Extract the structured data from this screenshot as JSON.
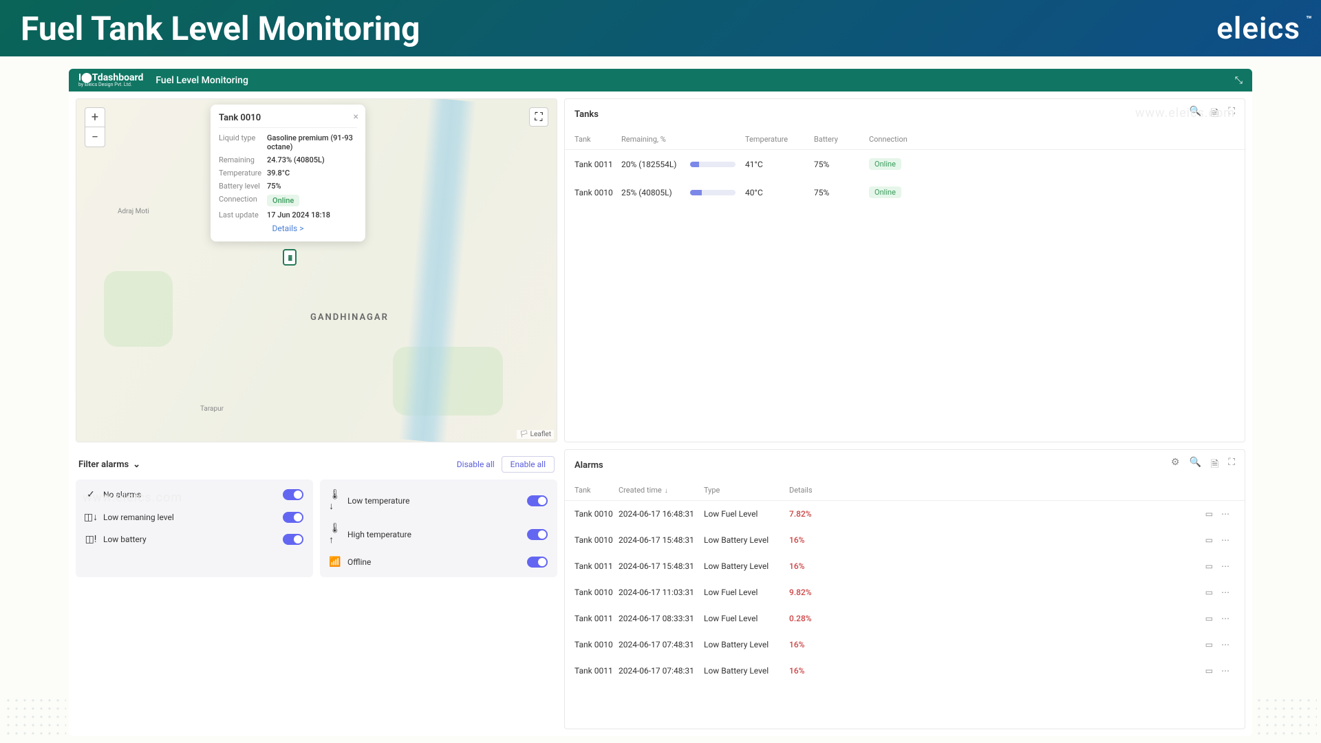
{
  "page": {
    "title": "Fuel Tank Level Monitoring",
    "brand": "eleics",
    "watermark": "www.eleics.com"
  },
  "dashboard": {
    "logo": "I⬤Tdashboard",
    "logo_sub": "by Eleics Design Pvt. Ltd.",
    "title": "Fuel Level Monitoring"
  },
  "map": {
    "city_label": "GANDHINAGAR",
    "place1": "Adraj Moti",
    "place2": "Tarapur",
    "leaflet": "Leaflet"
  },
  "popup": {
    "title": "Tank 0010",
    "details_link": "Details >",
    "labels": {
      "liquid": "Liquid type",
      "remaining": "Remaining",
      "temperature": "Temperature",
      "battery": "Battery level",
      "connection": "Connection",
      "last_update": "Last update"
    },
    "values": {
      "liquid": "Gasoline premium (91-93 octane)",
      "remaining": "24.73% (40805L)",
      "temperature": "39.8°C",
      "battery": "75%",
      "connection": "Online",
      "last_update": "17 Jun 2024 18:18"
    }
  },
  "filters": {
    "title": "Filter alarms",
    "disable_all": "Disable all",
    "enable_all": "Enable all",
    "left": [
      {
        "icon": "✓",
        "label": "No alarms"
      },
      {
        "icon": "◫↓",
        "label": "Low remaning level"
      },
      {
        "icon": "◫!",
        "label": "Low battery"
      }
    ],
    "right": [
      {
        "icon": "🌡↓",
        "label": "Low temperature"
      },
      {
        "icon": "🌡↑",
        "label": "High temperature"
      },
      {
        "icon": "📶",
        "label": "Offline"
      }
    ]
  },
  "tanks": {
    "title": "Tanks",
    "headers": {
      "tank": "Tank",
      "remaining": "Remaining, %",
      "temperature": "Temperature",
      "battery": "Battery",
      "connection": "Connection"
    },
    "rows": [
      {
        "tank": "Tank 0011",
        "remaining": "20% (182554L)",
        "pct": 20,
        "temperature": "41°C",
        "battery": "75%",
        "connection": "Online"
      },
      {
        "tank": "Tank 0010",
        "remaining": "25% (40805L)",
        "pct": 25,
        "temperature": "40°C",
        "battery": "75%",
        "connection": "Online"
      }
    ]
  },
  "alarms": {
    "title": "Alarms",
    "headers": {
      "tank": "Tank",
      "created": "Created time",
      "type": "Type",
      "details": "Details"
    },
    "rows": [
      {
        "tank": "Tank 0010",
        "created": "2024-06-17 16:48:31",
        "type": "Low Fuel Level",
        "details": "7.82%"
      },
      {
        "tank": "Tank 0010",
        "created": "2024-06-17 15:48:31",
        "type": "Low Battery Level",
        "details": "16%"
      },
      {
        "tank": "Tank 0011",
        "created": "2024-06-17 15:48:31",
        "type": "Low Battery Level",
        "details": "16%"
      },
      {
        "tank": "Tank 0010",
        "created": "2024-06-17 11:03:31",
        "type": "Low Fuel Level",
        "details": "9.82%"
      },
      {
        "tank": "Tank 0011",
        "created": "2024-06-17 08:33:31",
        "type": "Low Fuel Level",
        "details": "0.28%"
      },
      {
        "tank": "Tank 0010",
        "created": "2024-06-17 07:48:31",
        "type": "Low Battery Level",
        "details": "16%"
      },
      {
        "tank": "Tank 0011",
        "created": "2024-06-17 07:48:31",
        "type": "Low Battery Level",
        "details": "16%"
      }
    ]
  }
}
